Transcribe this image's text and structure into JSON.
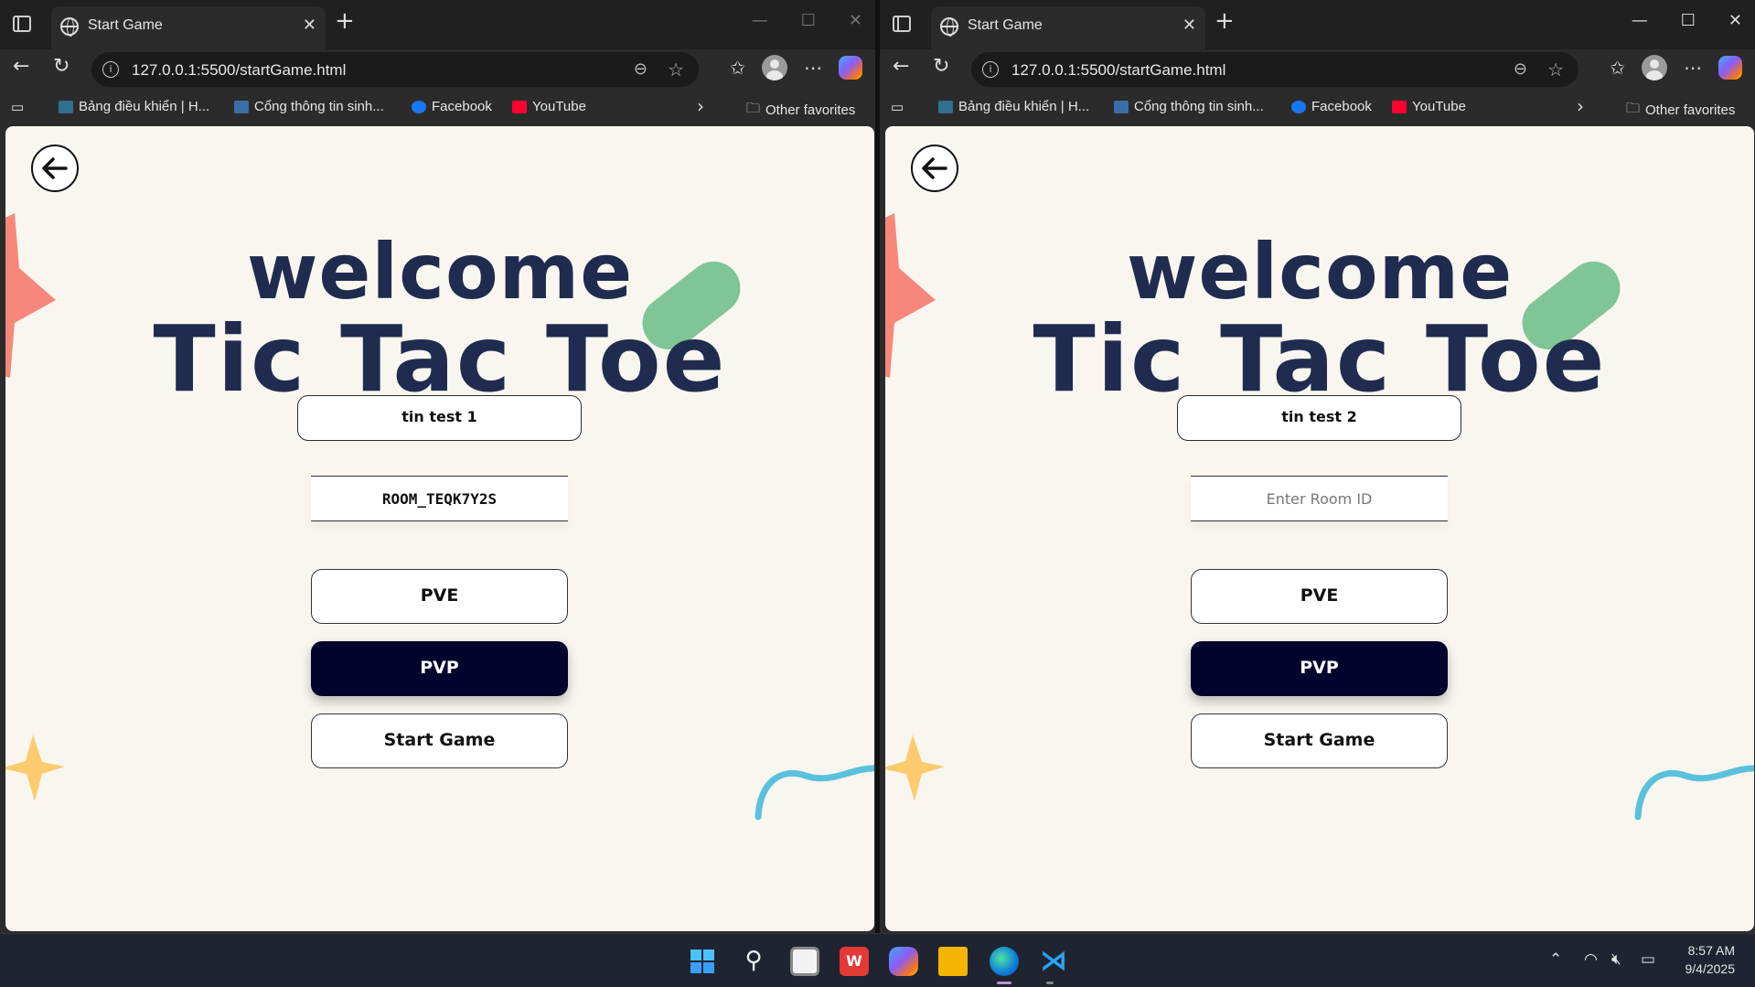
{
  "browser": {
    "tab_title": "Start Game",
    "tab_close": "✕",
    "new_tab": "+",
    "url": "127.0.0.1:5500/startGame.html",
    "favorites": [
      {
        "label": "Bảng điều khiển | H..."
      },
      {
        "label": "Cổng thông tin sinh..."
      },
      {
        "label": "Facebook"
      },
      {
        "label": "YouTube"
      }
    ],
    "other_favorites": "Other favorites",
    "win_controls": {
      "minimize": "—",
      "maximize": "☐",
      "close": "✕"
    }
  },
  "left_page": {
    "welcome": "welcome",
    "title": "Tic Tac Toe",
    "player_name": "tin test 1",
    "room_input_value": "ROOM_TEQK7Y2S",
    "room_input_placeholder": "Enter Room ID",
    "pve_label": "PVE",
    "pvp_label": "PVP",
    "start_label": "Start Game"
  },
  "right_page": {
    "welcome": "welcome",
    "title": "Tic Tac Toe",
    "player_name": "tin test 2",
    "room_input_value": "",
    "room_input_placeholder": "Enter Room ID",
    "pve_label": "PVE",
    "pvp_label": "PVP",
    "start_label": "Start Game"
  },
  "colors": {
    "title": "#1f2c4f",
    "pvp_bg": "#03032e",
    "page_bg": "#f9f6ef",
    "deco_pink": "#f7877b",
    "deco_green": "#7fc596",
    "deco_yellow": "#fdcb6e",
    "deco_blue": "#5bc0de"
  },
  "taskbar": {
    "icons": [
      "windows-start-icon",
      "search-icon",
      "microsoft-store-icon",
      "wps-office-icon",
      "copilot-icon",
      "file-explorer-icon",
      "edge-icon",
      "vscode-icon"
    ],
    "time": "8:57 AM",
    "date": "9/4/2025"
  }
}
